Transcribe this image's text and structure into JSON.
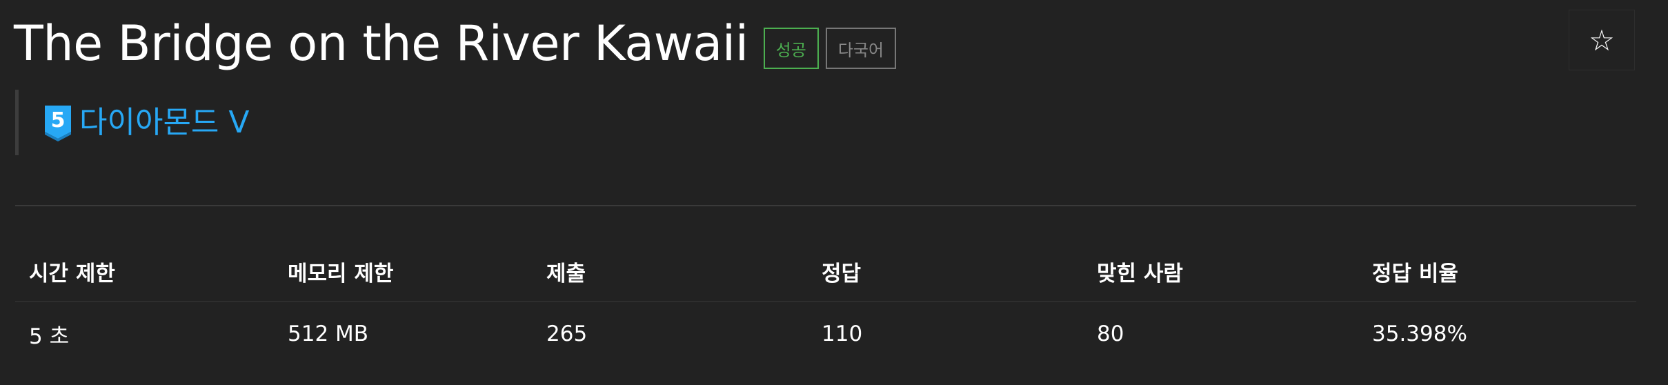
{
  "problem": {
    "title": "The Bridge on the River Kawaii",
    "badges": {
      "success": "성공",
      "multilang": "다국어"
    },
    "star_icon": "☆"
  },
  "tier": {
    "level_number": "5",
    "label": "다이아몬드 V",
    "icon": "diamond-tier-badge-icon",
    "color": "#27a8f5"
  },
  "stats": {
    "headers": [
      "시간 제한",
      "메모리 제한",
      "제출",
      "정답",
      "맞힌 사람",
      "정답 비율"
    ],
    "values": [
      "5 초",
      "512 MB",
      "265",
      "110",
      "80",
      "35.398%"
    ]
  },
  "colors": {
    "background": "#222222",
    "success": "#4caf50",
    "multilang": "#888888",
    "tier": "#27a8f5"
  }
}
